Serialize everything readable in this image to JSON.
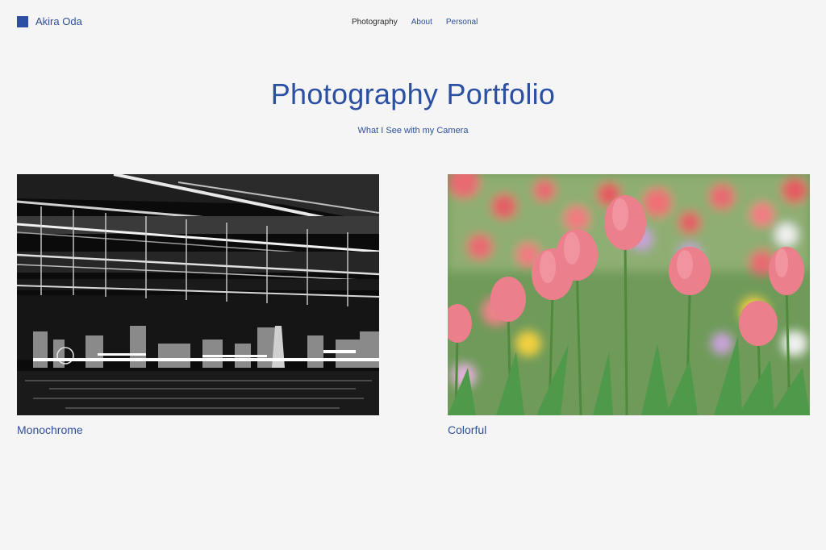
{
  "site": {
    "name": "Akira Oda",
    "accent_color": "#2a4fa3"
  },
  "nav": {
    "items": [
      {
        "label": "Photography",
        "current": true
      },
      {
        "label": "About",
        "current": false
      },
      {
        "label": "Personal",
        "current": false
      }
    ]
  },
  "hero": {
    "title": "Photography Portfolio",
    "subtitle": "What I See with my Camera"
  },
  "gallery": {
    "items": [
      {
        "label": "Monochrome",
        "image": "black-and-white-night-cityscape-under-bridge"
      },
      {
        "label": "Colorful",
        "image": "pink-tulips-field"
      }
    ]
  }
}
